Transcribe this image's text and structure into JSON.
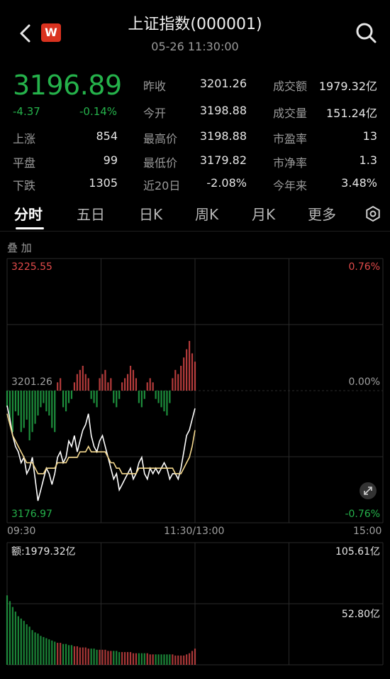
{
  "header": {
    "title": "上证指数(000001)",
    "datetime": "05-26 11:30:00",
    "logo_text": "W",
    "back_icon": "chevron-left-icon",
    "search_icon": "search-icon"
  },
  "quote": {
    "price": "3196.89",
    "change": "-4.37",
    "change_pct": "-0.14%",
    "fields": {
      "prev_close_label": "昨收",
      "prev_close": "3201.26",
      "amount_label": "成交额",
      "amount": "1979.32亿",
      "open_label": "今开",
      "open": "3198.88",
      "volume_label": "成交量",
      "volume": "151.24亿",
      "up_label": "上涨",
      "up": "854",
      "high_label": "最高价",
      "high": "3198.88",
      "pe_label": "市盈率",
      "pe": "13",
      "flat_label": "平盘",
      "flat": "99",
      "low_label": "最低价",
      "low": "3179.82",
      "pb_label": "市净率",
      "pb": "1.3",
      "down_label": "下跌",
      "down": "1305",
      "d20_label": "近20日",
      "d20": "-2.08%",
      "ytd_label": "今年来",
      "ytd": "3.48%"
    }
  },
  "tabs": [
    "分时",
    "五日",
    "日K",
    "周K",
    "月K",
    "更多"
  ],
  "active_tab": "分时",
  "overlay_label": "叠 加",
  "colors": {
    "up": "#e24a4a",
    "down": "#25b24b",
    "price_line": "#ffffff",
    "avg_line": "#f5d98f"
  },
  "chart_data": {
    "type": "line",
    "y_ticks_left": [
      "3225.55",
      "3201.26",
      "3176.97"
    ],
    "y_ticks_right": [
      "0.76%",
      "0.00%",
      "-0.76%"
    ],
    "x_ticks": [
      "09:30",
      "11:30/13:00",
      "15:00"
    ],
    "prev_close": 3201.26,
    "ylim": [
      3176.97,
      3225.55
    ],
    "series": [
      {
        "values": [
          3198.5,
          3196,
          3193,
          3191,
          3190,
          3188,
          3189,
          3186,
          3187,
          3189,
          3185,
          3181,
          3183,
          3185,
          3187,
          3186,
          3184,
          3186,
          3189,
          3190,
          3188,
          3189,
          3192,
          3191,
          3193,
          3190,
          3192,
          3194,
          3195,
          3197,
          3193,
          3191,
          3190,
          3192,
          3193,
          3191,
          3189,
          3187,
          3185,
          3186,
          3183,
          3184,
          3185,
          3186,
          3187,
          3185,
          3186,
          3188,
          3189,
          3186,
          3185,
          3187,
          3186,
          3187,
          3186,
          3187,
          3188,
          3187,
          3185,
          3186,
          3186,
          3185,
          3187,
          3190,
          3193,
          3194,
          3196,
          3198
        ]
      },
      {
        "values": [
          3197,
          3195,
          3193,
          3192,
          3191,
          3190,
          3189,
          3188,
          3188,
          3188,
          3187,
          3186,
          3186,
          3186,
          3187,
          3187,
          3187,
          3187,
          3188,
          3188,
          3188,
          3188,
          3189,
          3189,
          3189,
          3189,
          3190,
          3190,
          3190,
          3191,
          3190,
          3190,
          3190,
          3190,
          3190,
          3190,
          3189,
          3188,
          3188,
          3187,
          3187,
          3186,
          3186,
          3186,
          3186,
          3186,
          3186,
          3187,
          3187,
          3187,
          3187,
          3187,
          3187,
          3187,
          3187,
          3187,
          3187,
          3187,
          3187,
          3187,
          3186,
          3186,
          3186,
          3187,
          3188,
          3189,
          3191,
          3194
        ]
      }
    ],
    "bars": [
      -4,
      -8,
      -10,
      -5,
      -6,
      -10,
      -9,
      -7,
      -12,
      -10,
      -8,
      -6,
      -4,
      -3,
      -5,
      -6,
      -9,
      -10,
      2,
      3,
      -4,
      -5,
      -3,
      -2,
      2,
      4,
      5,
      6,
      4,
      3,
      -2,
      -3,
      -4,
      3,
      4,
      5,
      2,
      3,
      -3,
      -4,
      -2,
      2,
      3,
      4,
      6,
      5,
      3,
      -3,
      -4,
      -2,
      2,
      3,
      2,
      -2,
      -3,
      -4,
      -5,
      -6,
      -3,
      3,
      5,
      4,
      6,
      8,
      10,
      12,
      9,
      7
    ],
    "volume": {
      "label": "额:1979.32亿",
      "y_ticks": [
        "105.61亿",
        "52.80亿"
      ],
      "ymax": 105.61,
      "values": [
        60,
        55,
        50,
        46,
        42,
        40,
        38,
        35,
        33,
        30,
        28,
        27,
        25,
        24,
        23,
        22,
        21,
        20,
        19,
        19,
        18,
        18,
        17,
        17,
        16,
        16,
        15,
        15,
        15,
        14,
        14,
        14,
        13,
        13,
        13,
        13,
        12,
        12,
        12,
        12,
        11,
        11,
        11,
        11,
        11,
        10,
        10,
        10,
        10,
        10,
        10,
        9,
        9,
        9,
        9,
        9,
        9,
        9,
        9,
        9,
        8,
        8,
        8,
        8,
        9,
        10,
        12,
        14
      ]
    }
  }
}
